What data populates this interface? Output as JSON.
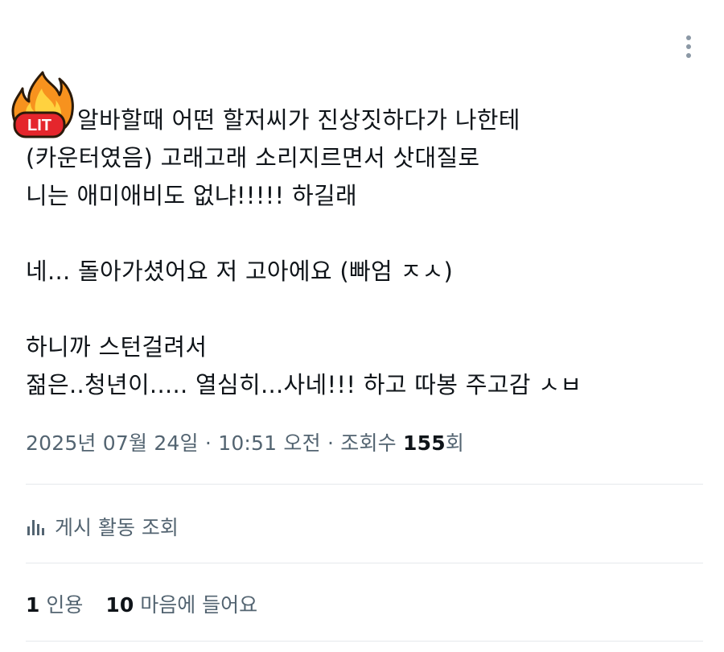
{
  "tweet": {
    "emoji_icon": "lit-fire-icon",
    "text_lines": [
      "알바할때 어떤 할저씨가 진상짓하다가 나한테",
      "(카운터였음) 고래고래 소리지르면서 삿대질로",
      "니는 애미애비도 없냐!!!!! 하길래",
      "",
      "네... 돌아가셨어요 저 고아에요 (빠엄 ㅈㅅ)",
      "",
      "하니까 스턴걸려서",
      "젊은..청년이..... 열심히...사네!!! 하고 따봉 주고감 ㅅㅂ"
    ],
    "lit_label": "LIT"
  },
  "meta": {
    "date": "2025년 07월 24일",
    "time": "10:51 오전",
    "separator": "·",
    "views_label": "조회수",
    "views_count": "155",
    "views_suffix": "회"
  },
  "activity": {
    "label": "게시 활동 조회",
    "icon": "bar-chart-icon"
  },
  "stats": {
    "quotes_count": "1",
    "quotes_label": "인용",
    "likes_count": "10",
    "likes_label": "마음에 들어요"
  },
  "colors": {
    "text": "#0f1419",
    "secondary": "#536471",
    "divider": "#e6e9ec",
    "fire_orange": "#f7921e",
    "fire_yellow": "#ffd23f",
    "lit_red": "#e5262c"
  }
}
